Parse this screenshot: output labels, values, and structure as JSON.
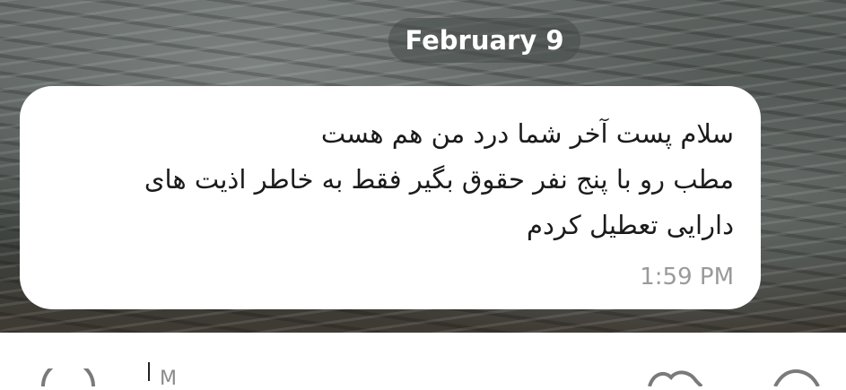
{
  "chat": {
    "date_label": "February 9",
    "message": {
      "lines": [
        "سلام پست آخر شما درد من هم هست",
        "مطب رو با پنج نفر حقوق بگیر فقط به خاطر اذیت های",
        "دارایی تعطیل کردم"
      ],
      "time": "1:59 PM"
    }
  },
  "input_bar": {
    "placeholder_partial": "M",
    "icons": [
      "emoji-icon",
      "attach-icon",
      "voice-icon"
    ]
  }
}
